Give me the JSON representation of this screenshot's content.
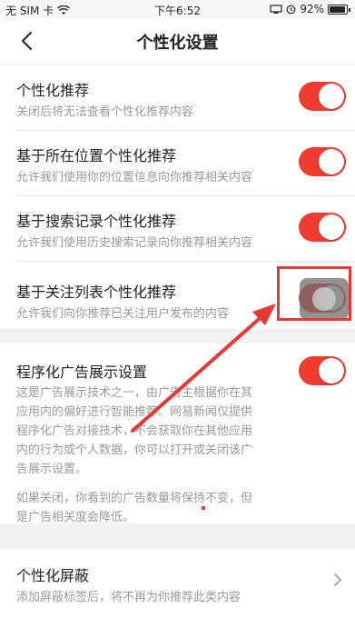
{
  "status_bar": {
    "carrier": "无 SIM 卡",
    "time": "下午6:52",
    "battery": "92%",
    "battery_level": 0.92
  },
  "nav": {
    "title": "个性化设置",
    "back_icon": "chevron-left-icon"
  },
  "settings": [
    {
      "title": "个性化推荐",
      "desc": "关闭后将无法查看个性化推荐内容",
      "enabled": true
    },
    {
      "title": "基于所在位置个性化推荐",
      "desc": "允许我们使用你的位置信息向你推荐相关内容",
      "enabled": true
    },
    {
      "title": "基于搜索记录个性化推荐",
      "desc": "允许我们使用历史搜索记录向你推荐相关内容",
      "enabled": true
    },
    {
      "title": "基于关注列表个性化推荐",
      "desc": "允许我们向你推荐已关注用户发布的内容",
      "enabled": true
    }
  ],
  "ad": {
    "title": "程序化广告展示设置",
    "enabled": true,
    "desc_lines": [
      "这是广告展示技术之一，由广告主根据你在其",
      "应用内的偏好进行智能推荐。网易新闻仅提供",
      "程序化广告对接技术，不会获取你在其他应用",
      "内的行为或个人数据，你可以打开或关闭该广",
      "告展示设置。"
    ],
    "desc_lines_2": [
      "如果关闭，你看到的广告数量将保持不变，但",
      "是广告相关度会降低。"
    ]
  },
  "shield": {
    "title": "个性化屏蔽",
    "desc": "添加屏蔽标签后，将不再为你推荐此类内容"
  },
  "colors": {
    "accent": "#f03b30",
    "annotation": "#e53935"
  }
}
